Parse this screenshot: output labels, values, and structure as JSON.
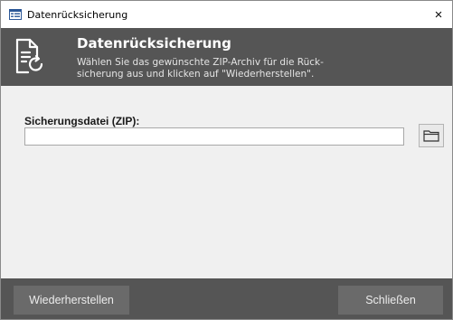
{
  "window": {
    "title": "Datenrücksicherung",
    "close_symbol": "×",
    "title_icon": "form-icon"
  },
  "header": {
    "icon": "document-restore-icon",
    "title": "Datenrücksicherung",
    "description": "Wählen Sie das gewünschte ZIP-Archiv für die Rück-\nsicherung aus und klicken auf \"Wiederherstellen\"."
  },
  "form": {
    "backup_file_label": "Sicherungsdatei (ZIP):",
    "backup_file_value": "",
    "browse_icon": "folder-icon"
  },
  "footer": {
    "restore_label": "Wiederherstellen",
    "close_label": "Schließen"
  },
  "colors": {
    "header_bg": "#555555",
    "footer_bg": "#555555",
    "button_bg": "#6a6a6a",
    "body_bg": "#f0f0f0"
  }
}
